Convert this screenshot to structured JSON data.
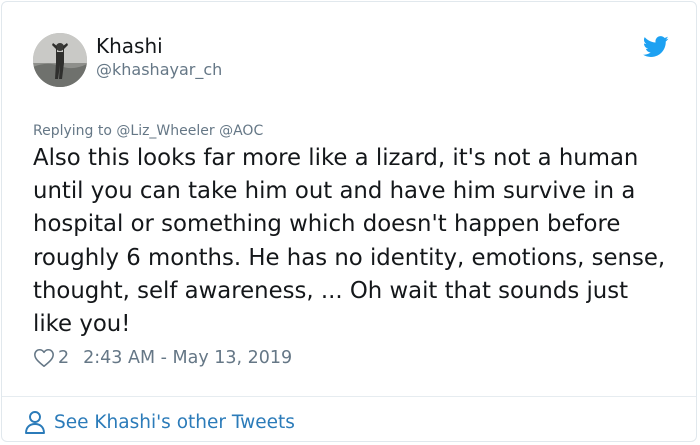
{
  "tweet": {
    "author_name": "Khashi",
    "author_handle": "@khashayar_ch",
    "replying_prefix": "Replying to",
    "replying_to": [
      "@Liz_Wheeler",
      "@AOC"
    ],
    "text": "Also this looks far more like a lizard, it's not a human until you can take him out and have him survive in a hospital or something which doesn't happen before roughly 6 months. He has no identity, emotions, sense, thought, self awareness, ... Oh wait that sounds just like you!",
    "like_count": "2",
    "timestamp": "2:43 AM - May 13, 2019"
  },
  "footer": {
    "label": "See Khashi's other Tweets"
  },
  "icons": {
    "brand": "twitter-bird-icon",
    "like": "heart-outline-icon",
    "profile": "person-outline-icon"
  },
  "colors": {
    "twitter_blue": "#1da1f2",
    "link_blue": "#2b7bb9",
    "text": "#14171a",
    "secondary": "#657786",
    "border": "#e1e8ed"
  }
}
